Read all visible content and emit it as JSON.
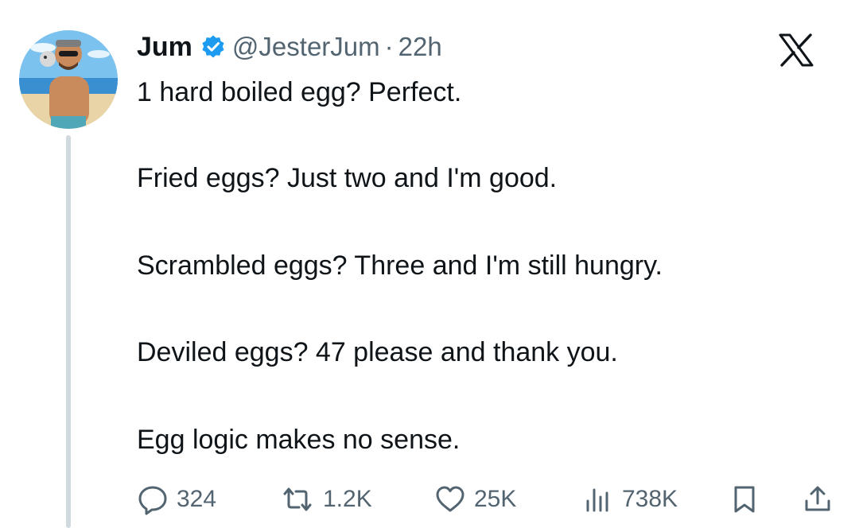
{
  "tweet": {
    "author_name": "Jum",
    "handle": "@JesterJum",
    "separator": "·",
    "time": "22h",
    "lines": [
      "1 hard boiled egg? Perfect.",
      "Fried eggs? Just two and I'm good.",
      "Scrambled eggs? Three and I'm still hungry.",
      "Deviled eggs? 47 please and thank you.",
      "Egg logic makes no sense."
    ]
  },
  "actions": {
    "replies": "324",
    "reposts": "1.2K",
    "likes": "25K",
    "views": "738K"
  },
  "icons": {
    "reply": "reply-icon",
    "repost": "repost-icon",
    "like": "heart-icon",
    "views": "views-chart-icon",
    "bookmark": "bookmark-icon",
    "share": "share-icon",
    "verified": "verified-badge-icon",
    "platform": "x-logo-icon"
  },
  "colors": {
    "verified": "#1d9bf0",
    "muted": "#536471",
    "text": "#0f1419",
    "thread_line": "#cfd9de"
  }
}
